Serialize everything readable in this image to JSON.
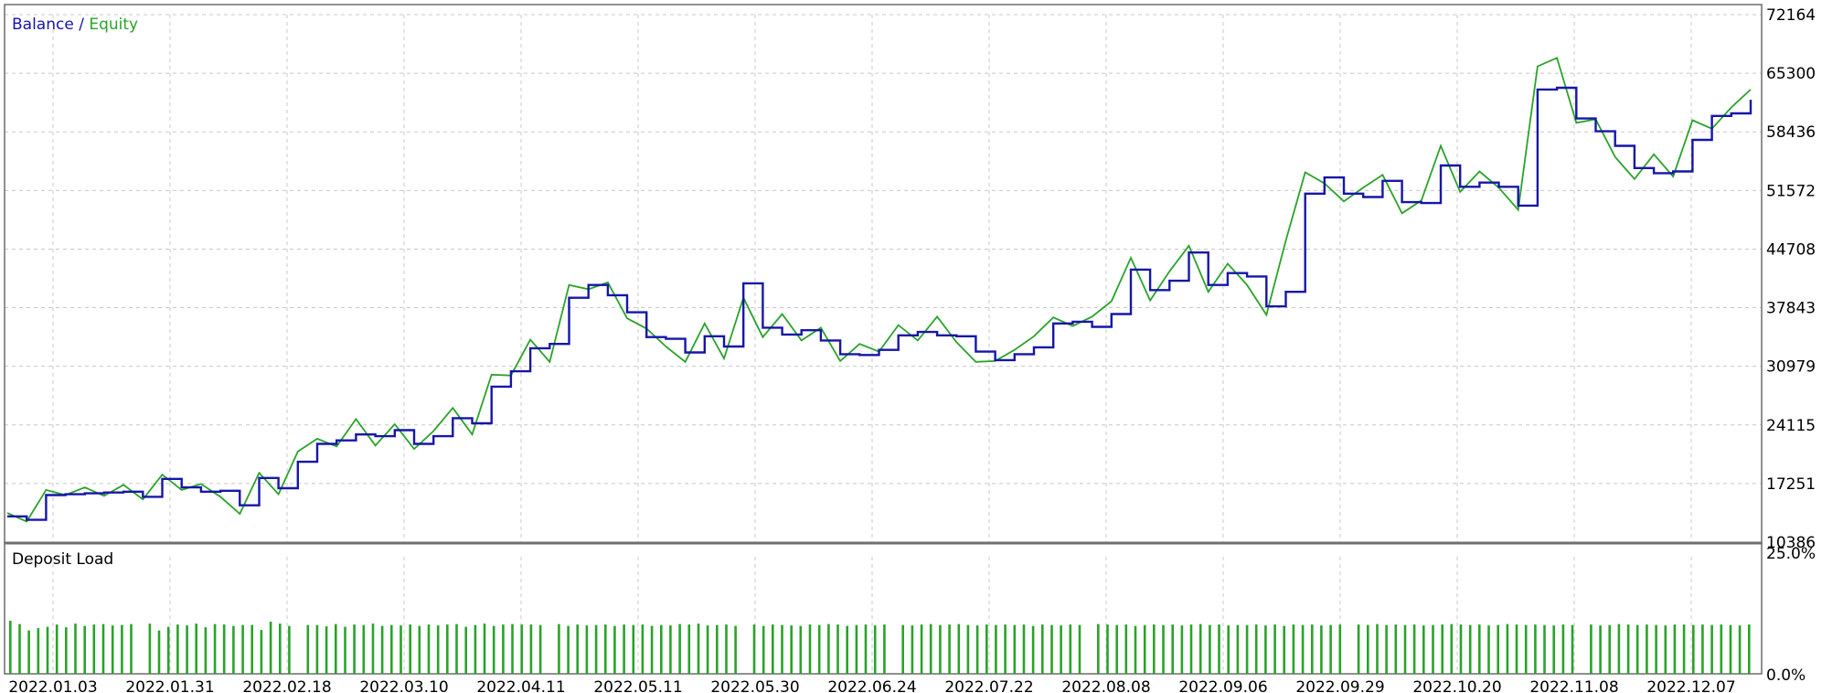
{
  "chart_data": [
    {
      "type": "line",
      "title_parts": [
        "Balance",
        " / ",
        "Equity"
      ],
      "ylim": [
        10386,
        72164
      ],
      "y_ticks": [
        "72164",
        "65300",
        "58436",
        "51572",
        "44708",
        "37843",
        "30979",
        "24115",
        "17251",
        "10386"
      ],
      "x_ticks": [
        "2022.01.03",
        "2022.01.31",
        "2022.02.18",
        "2022.03.10",
        "2022.04.11",
        "2022.05.11",
        "2022.05.30",
        "2022.06.24",
        "2022.07.22",
        "2022.08.08",
        "2022.09.06",
        "2022.09.29",
        "2022.10.20",
        "2022.11.08",
        "2022.12.07"
      ],
      "grid": true,
      "colors": {
        "balance": "#1616a8",
        "equity": "#2aa32a"
      },
      "series": [
        {
          "name": "Balance",
          "values": [
            13400,
            13000,
            15900,
            16000,
            16100,
            16200,
            16300,
            15700,
            17800,
            16800,
            16300,
            16400,
            14700,
            17900,
            16700,
            19800,
            21900,
            22300,
            23000,
            22800,
            23500,
            21900,
            22800,
            24900,
            24300,
            28600,
            30400,
            33100,
            33600,
            39000,
            40500,
            39300,
            37300,
            34400,
            34200,
            32600,
            34500,
            33300,
            40700,
            35500,
            34700,
            35200,
            34000,
            32400,
            32300,
            32900,
            34600,
            35000,
            34600,
            34500,
            32700,
            31700,
            32400,
            33200,
            36000,
            36200,
            35600,
            37100,
            42300,
            39900,
            41000,
            44300,
            40500,
            41900,
            41500,
            38000,
            39700,
            51200,
            53100,
            51200,
            50800,
            52700,
            50200,
            50100,
            54500,
            52000,
            52500,
            52000,
            49800,
            63400,
            63600,
            60000,
            58500,
            56800,
            54200,
            53600,
            53800,
            57500,
            60300,
            60600,
            62200
          ]
        },
        {
          "name": "Equity",
          "values": [
            13800,
            12800,
            16500,
            15900,
            16800,
            15800,
            17100,
            15400,
            18300,
            16500,
            17200,
            15700,
            13700,
            18500,
            16000,
            21000,
            22500,
            21600,
            24800,
            21700,
            24200,
            21300,
            23400,
            26100,
            23000,
            30000,
            29900,
            34100,
            31500,
            40500,
            40000,
            40800,
            36600,
            35400,
            33300,
            31500,
            36000,
            31900,
            39000,
            34400,
            37100,
            34000,
            35500,
            31600,
            33600,
            32700,
            35800,
            34000,
            36800,
            33800,
            31500,
            31600,
            32900,
            34500,
            36700,
            35700,
            36800,
            38600,
            43700,
            38700,
            42100,
            45100,
            39700,
            43000,
            40500,
            37000,
            45700,
            53700,
            52400,
            50300,
            51900,
            53400,
            48900,
            50400,
            56800,
            51400,
            53800,
            51900,
            49300,
            66100,
            67100,
            59500,
            59900,
            55500,
            52900,
            55800,
            53200,
            59800,
            58800,
            61300,
            63400
          ]
        }
      ]
    },
    {
      "type": "bar",
      "title": "Deposit Load",
      "y_ticks": [
        "25.0%",
        "0.0%"
      ],
      "ylim": [
        0,
        25
      ],
      "color": "#2aa32a",
      "values": [
        11.5,
        10.8,
        9.4,
        9.9,
        10.2,
        10.7,
        10.1,
        10.9,
        10.4,
        10.7,
        10.8,
        10.5,
        10.6,
        10.8,
        0,
        10.9,
        9.4,
        10.2,
        10.7,
        10.5,
        10.9,
        10.1,
        10.8,
        10.7,
        10.4,
        10.6,
        10.6,
        9.5,
        11.3,
        10.9,
        10.4,
        0,
        10.6,
        10.6,
        10.3,
        10.8,
        10.2,
        10.7,
        10.6,
        10.9,
        10.4,
        10.6,
        10.5,
        10.7,
        10.4,
        10.7,
        10.5,
        10.7,
        10.8,
        10.2,
        10.6,
        10.9,
        10.4,
        10.7,
        10.8,
        10.7,
        10.7,
        10.6,
        0,
        10.8,
        10.4,
        10.7,
        10.5,
        10.6,
        10.7,
        10.4,
        10.7,
        10.6,
        10.7,
        10.4,
        10.6,
        10.5,
        10.8,
        10.7,
        10.9,
        10.5,
        10.6,
        10.7,
        10.4,
        0,
        10.7,
        10.4,
        10.7,
        10.6,
        10.5,
        10.4,
        10.7,
        10.6,
        10.8,
        10.7,
        10.4,
        10.6,
        10.7,
        10.5,
        10.7,
        0,
        10.6,
        10.5,
        10.7,
        10.8,
        10.6,
        10.7,
        10.8,
        10.6,
        10.5,
        10.7,
        10.6,
        10.7,
        10.6,
        10.7,
        10.4,
        10.7,
        10.6,
        10.5,
        10.7,
        10.6,
        0,
        10.8,
        10.7,
        10.6,
        10.7,
        10.4,
        10.6,
        10.7,
        10.6,
        10.7,
        10.5,
        10.7,
        10.8,
        10.6,
        10.7,
        10.5,
        10.6,
        10.6,
        10.7,
        10.5,
        10.7,
        10.4,
        10.7,
        10.6,
        10.7,
        10.5,
        10.6,
        10.7,
        0,
        10.7,
        10.6,
        10.8,
        10.6,
        10.7,
        10.6,
        10.7,
        10.5,
        10.6,
        10.7,
        10.8,
        10.7,
        10.6,
        10.7,
        10.5,
        10.6,
        10.8,
        10.7,
        10.6,
        10.7,
        10.6,
        10.5,
        10.7,
        10.6,
        0,
        10.7,
        10.5,
        10.6,
        10.8,
        10.7,
        10.6,
        10.7,
        10.6,
        10.5,
        10.7,
        10.7,
        10.6,
        10.7,
        10.6,
        10.7,
        10.6,
        10.5,
        10.7
      ]
    }
  ]
}
